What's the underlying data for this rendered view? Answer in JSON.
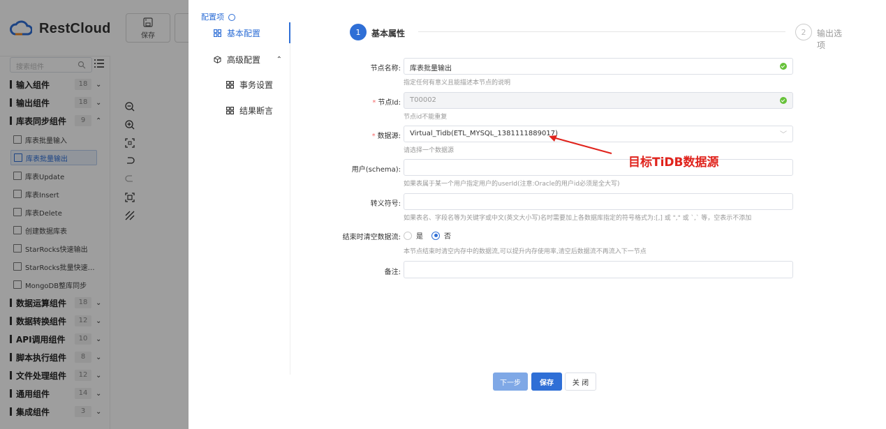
{
  "app": {
    "brand": "RestCloud",
    "toolbar": {
      "save_label": "保存"
    },
    "search": {
      "placeholder": "搜索组件"
    },
    "groups": [
      {
        "name": "输入组件",
        "count": "18",
        "expanded": false
      },
      {
        "name": "输出组件",
        "count": "18",
        "expanded": false
      },
      {
        "name": "库表同步组件",
        "count": "9",
        "expanded": true
      },
      {
        "name": "数据运算组件",
        "count": "18",
        "expanded": false
      },
      {
        "name": "数据转换组件",
        "count": "12",
        "expanded": false
      },
      {
        "name": "API调用组件",
        "count": "10",
        "expanded": false
      },
      {
        "name": "脚本执行组件",
        "count": "8",
        "expanded": false
      },
      {
        "name": "文件处理组件",
        "count": "12",
        "expanded": false
      },
      {
        "name": "通用组件",
        "count": "14",
        "expanded": false
      },
      {
        "name": "集成组件",
        "count": "3",
        "expanded": false
      }
    ],
    "sync_items": [
      {
        "label": "库表批量输入",
        "active": false
      },
      {
        "label": "库表批量输出",
        "active": true
      },
      {
        "label": "库表Update",
        "active": false
      },
      {
        "label": "库表Insert",
        "active": false
      },
      {
        "label": "库表Delete",
        "active": false
      },
      {
        "label": "创建数据库表",
        "active": false
      },
      {
        "label": "StarRocks快速输出",
        "active": false
      },
      {
        "label": "StarRocks批量快速…",
        "active": false
      },
      {
        "label": "MongoDB整库同步",
        "active": false
      }
    ]
  },
  "drawer": {
    "config_label": "配置项",
    "nav": {
      "basic": "基本配置",
      "advanced": "高级配置",
      "transaction": "事务设置",
      "assertion": "结果断言"
    },
    "steps": [
      {
        "num": "1",
        "label": "基本属性",
        "active": true
      },
      {
        "num": "2",
        "label": "输出选项",
        "active": false
      }
    ],
    "form": {
      "node_name": {
        "label": "节点名称:",
        "value": "库表批量输出",
        "hint": "指定任何有意义且能描述本节点的说明"
      },
      "node_id": {
        "label": "节点Id:",
        "value": "T00002",
        "hint": "节点id不能重复"
      },
      "datasource": {
        "label": "数据源:",
        "value": "Virtual_Tidb(ETL_MYSQL_1381111889017)",
        "hint": "请选择一个数据源"
      },
      "schema": {
        "label": "用户(schema):",
        "value": "",
        "hint": "如果表属于某一个用户指定用户的userId(注意:Oracle的用户id必须是全大写)"
      },
      "escape": {
        "label": "转义符号:",
        "value": "",
        "hint": "如果表名、字段名等为关键字或中文(英文大小写)名时需要加上各数据库指定的符号格式为:[,] 或 \",\" 或 `,` 等，空表示不添加"
      },
      "clear_stream": {
        "label": "结束时清空数据流:",
        "yes": "是",
        "no": "否",
        "selected": "no",
        "hint": "本节点结束时清空内存中的数据流,可以提升内存使用率,清空后数据流不再流入下一节点"
      },
      "remark": {
        "label": "备注:",
        "value": ""
      }
    },
    "annotation": "目标TiDB数据源",
    "buttons": {
      "next": "下一步",
      "save": "保存",
      "close": "关 闭"
    }
  },
  "colors": {
    "primary": "#2f6fd6",
    "success": "#67c23a",
    "annotation": "#e0231c",
    "required": "#f56c6c"
  }
}
